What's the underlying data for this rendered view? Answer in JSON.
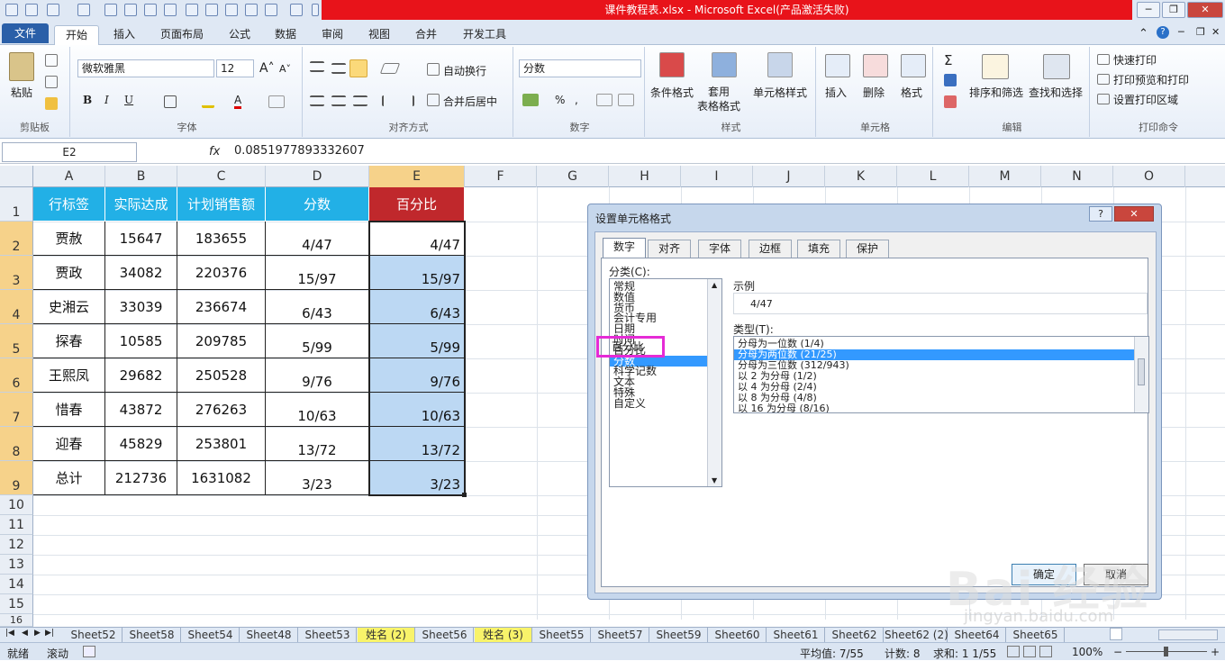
{
  "window": {
    "title": "课件教程表.xlsx - Microsoft Excel(产品激活失败)"
  },
  "ribbon_tabs": [
    "文件",
    "开始",
    "插入",
    "页面布局",
    "公式",
    "数据",
    "审阅",
    "视图",
    "合并",
    "开发工具"
  ],
  "ribbon": {
    "clipboard": {
      "paste": "粘贴",
      "label": "剪贴板"
    },
    "font": {
      "name": "微软雅黑",
      "size": "12",
      "bold": "B",
      "italic": "I",
      "underline": "U",
      "label": "字体"
    },
    "alignment": {
      "wrap": "自动换行",
      "merge": "合并后居中",
      "label": "对齐方式"
    },
    "number": {
      "format": "分数",
      "label": "数字"
    },
    "styles": {
      "cond": "条件格式",
      "table": "套用\n表格格式",
      "cell": "单元格样式",
      "label": "样式"
    },
    "cells": {
      "insert": "插入",
      "delete": "删除",
      "format": "格式",
      "label": "单元格"
    },
    "editing": {
      "sort": "排序和筛选",
      "find": "查找和选择",
      "label": "编辑"
    },
    "print": {
      "quick": "快速打印",
      "preview": "打印预览和打印",
      "area": "设置打印区域",
      "label": "打印命令"
    }
  },
  "formula_bar": {
    "name_box": "E2",
    "fx": "fx",
    "value": "0.0851977893332607"
  },
  "columns": [
    "A",
    "B",
    "C",
    "D",
    "E",
    "F",
    "G",
    "H",
    "I",
    "J",
    "K",
    "L",
    "M",
    "N",
    "O"
  ],
  "rows": [
    "1",
    "2",
    "3",
    "4",
    "5",
    "6",
    "7",
    "8",
    "9",
    "10",
    "11",
    "12",
    "13",
    "14",
    "15",
    "16"
  ],
  "table": {
    "headers": [
      "行标签",
      "实际达成",
      "计划销售额",
      "分数",
      "百分比"
    ],
    "rows": [
      [
        "贾赦",
        "15647",
        "183655",
        "4/47",
        "4/47"
      ],
      [
        "贾政",
        "34082",
        "220376",
        "15/97",
        "15/97"
      ],
      [
        "史湘云",
        "33039",
        "236674",
        "6/43",
        "6/43"
      ],
      [
        "探春",
        "10585",
        "209785",
        "5/99",
        "5/99"
      ],
      [
        "王熙凤",
        "29682",
        "250528",
        "9/76",
        "9/76"
      ],
      [
        "惜春",
        "43872",
        "276263",
        "10/63",
        "10/63"
      ],
      [
        "迎春",
        "45829",
        "253801",
        "13/72",
        "13/72"
      ],
      [
        "总计",
        "212736",
        "1631082",
        "3/23",
        "3/23"
      ]
    ]
  },
  "dialog": {
    "title": "设置单元格格式",
    "help": "?",
    "close": "✕",
    "tabs": [
      "数字",
      "对齐",
      "字体",
      "边框",
      "填充",
      "保护"
    ],
    "category_label": "分类(C):",
    "categories": [
      "常规",
      "数值",
      "货币",
      "会计专用",
      "日期",
      "时间",
      "百分比",
      "分数",
      "科学记数",
      "文本",
      "特殊",
      "自定义"
    ],
    "highlight_label": "百分比",
    "sample_label": "示例",
    "sample_value": "4/47",
    "type_label": "类型(T):",
    "types": [
      "分母为一位数 (1/4)",
      "分母为两位数 (21/25)",
      "分母为三位数 (312/943)",
      "以 2 为分母 (1/2)",
      "以 4 为分母 (2/4)",
      "以 8 为分母 (4/8)",
      "以 16 为分母 (8/16)"
    ],
    "ok": "确定",
    "cancel": "取消"
  },
  "sheet_tabs": [
    "Sheet52",
    "Sheet58",
    "Sheet54",
    "Sheet48",
    "Sheet53",
    "姓名 (2)",
    "Sheet56",
    "姓名 (3)",
    "Sheet55",
    "Sheet57",
    "Sheet59",
    "Sheet60",
    "Sheet61",
    "Sheet62",
    "Sheet62 (2)",
    "Sheet64",
    "Sheet65"
  ],
  "status": {
    "ready": "就绪",
    "scroll": "滚动",
    "average": "平均值: 7/55",
    "count": "计数: 8",
    "sum": "求和: 1 1/55",
    "zoom": "100%"
  },
  "watermark": {
    "brand": "Bai 经验",
    "url": "jingyan.baidu.com"
  },
  "colors": {
    "header_fill": "#22b0e6",
    "pct_header": "#c0282c",
    "selection": "#bcd8f3",
    "highlight_box": "#e52bd6"
  }
}
